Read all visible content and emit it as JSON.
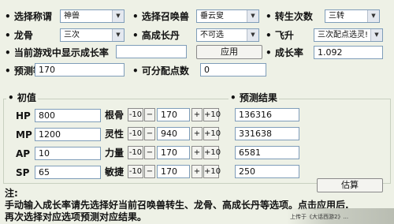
{
  "row1": {
    "title_label": "选择称谓",
    "title_value": "神兽",
    "summon_label": "选择召唤兽",
    "summon_value": "垂云叟",
    "rebirth_label": "转生次数",
    "rebirth_value": "三转"
  },
  "row2": {
    "dragon_label": "龙骨",
    "dragon_value": "三次",
    "pill_label": "高成长丹",
    "pill_value": "不可选",
    "ascend_label": "飞升",
    "ascend_value": "三次配点选灵!"
  },
  "row3": {
    "current_growth_label": "当前游戏中显示成长率",
    "current_growth_value": "",
    "apply_button": "应用",
    "growth_label": "成长率",
    "growth_value": "1.092"
  },
  "row4": {
    "predict_level_label": "预测等级",
    "predict_level_value": "170",
    "alloc_points_label": "可分配点数",
    "alloc_points_value": "0"
  },
  "initial_label": "初值",
  "result_label": "预测结果",
  "stats": [
    {
      "name": "HP",
      "value": "800"
    },
    {
      "name": "MP",
      "value": "1200"
    },
    {
      "name": "AP",
      "value": "10"
    },
    {
      "name": "SP",
      "value": "65"
    }
  ],
  "attrs": [
    {
      "name": "根骨",
      "value": "170"
    },
    {
      "name": "灵性",
      "value": "940"
    },
    {
      "name": "力量",
      "value": "170"
    },
    {
      "name": "敏捷",
      "value": "170"
    }
  ],
  "results": [
    "136316",
    "331638",
    "6581",
    "250"
  ],
  "minus10": "-10",
  "minus": "−",
  "plus": "+",
  "plus10": "+10",
  "estimate_button": "估算",
  "note_title": "注:",
  "note_line1": "手动输入成长率请先选择好当前召唤兽转生、龙骨、高成长丹等选项。点击应用后,",
  "note_line2": "再次选择对应选项预测对应结果。",
  "watermark": "上传于《大话西游2》..."
}
